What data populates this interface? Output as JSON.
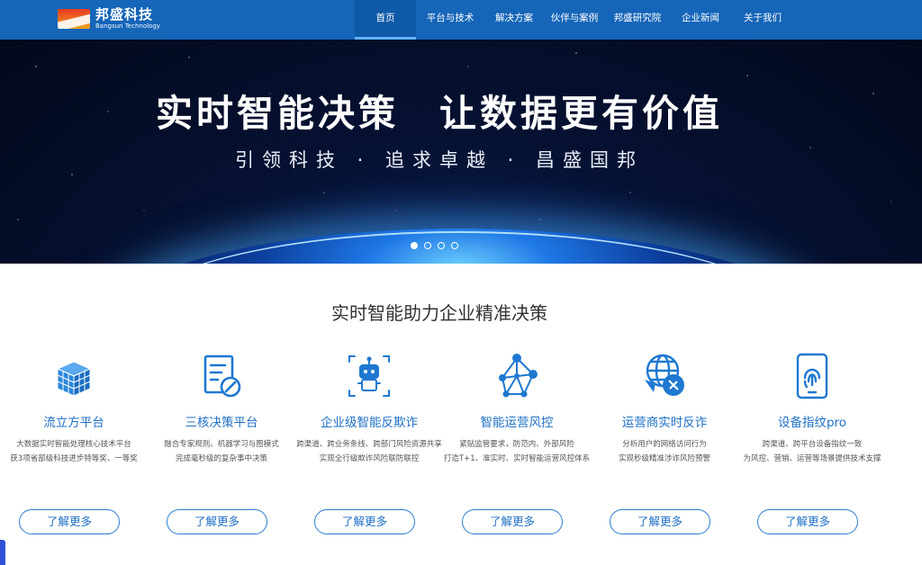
{
  "brand": {
    "name_cn": "邦盛科技",
    "name_en": "Bangsun Technology"
  },
  "nav": [
    {
      "label": "首页",
      "active": true
    },
    {
      "label": "平台与技术",
      "active": false
    },
    {
      "label": "解决方案",
      "active": false
    },
    {
      "label": "伙伴与案例",
      "active": false
    },
    {
      "label": "邦盛研究院",
      "active": false
    },
    {
      "label": "企业新闻",
      "active": false
    },
    {
      "label": "关于我们",
      "active": false
    }
  ],
  "banner": {
    "title": "实时智能决策　让数据更有价值",
    "subtitle": "引领科技 · 追求卓越 · 昌盛国邦",
    "slides": 4,
    "active_slide": 1
  },
  "section": {
    "title": "实时智能助力企业精准决策"
  },
  "cards": [
    {
      "icon": "cube-stack-icon",
      "title": "流立方平台",
      "desc": [
        "大数据实时智能处理核心技术平台",
        "获3项省部级科技进步特等奖、一等奖"
      ],
      "button": "了解更多"
    },
    {
      "icon": "decision-doc-icon",
      "title": "三核决策平台",
      "desc": [
        "融合专家规则、机器学习与图模式",
        "完成毫秒级的复杂事中决策"
      ],
      "button": "了解更多"
    },
    {
      "icon": "robot-icon",
      "title": "企业级智能反欺诈",
      "desc": [
        "跨渠道、跨业务条线、跨部门风险资源共享",
        "实现全行级欺诈风险联防联控"
      ],
      "button": "了解更多"
    },
    {
      "icon": "network-nodes-icon",
      "title": "智能运营风控",
      "desc": [
        "紧贴监管要求，防范内、外部风险",
        "打造T+1、准实时、实时智能运营风控体系"
      ],
      "button": "了解更多"
    },
    {
      "icon": "globe-phone-icon",
      "title": "运营商实时反诈",
      "desc": [
        "分析用户的网络访问行为",
        "实现秒级精准涉诈风险预警"
      ],
      "button": "了解更多"
    },
    {
      "icon": "fingerprint-device-icon",
      "title": "设备指纹pro",
      "desc": [
        "跨渠道、跨平台设备指纹一致",
        "为风控、营销、运营等场景提供技术支撑"
      ],
      "button": "了解更多"
    }
  ],
  "colors": {
    "header": "#1565b8",
    "accent": "#1f6fc4",
    "icon": "#1f78d1"
  }
}
